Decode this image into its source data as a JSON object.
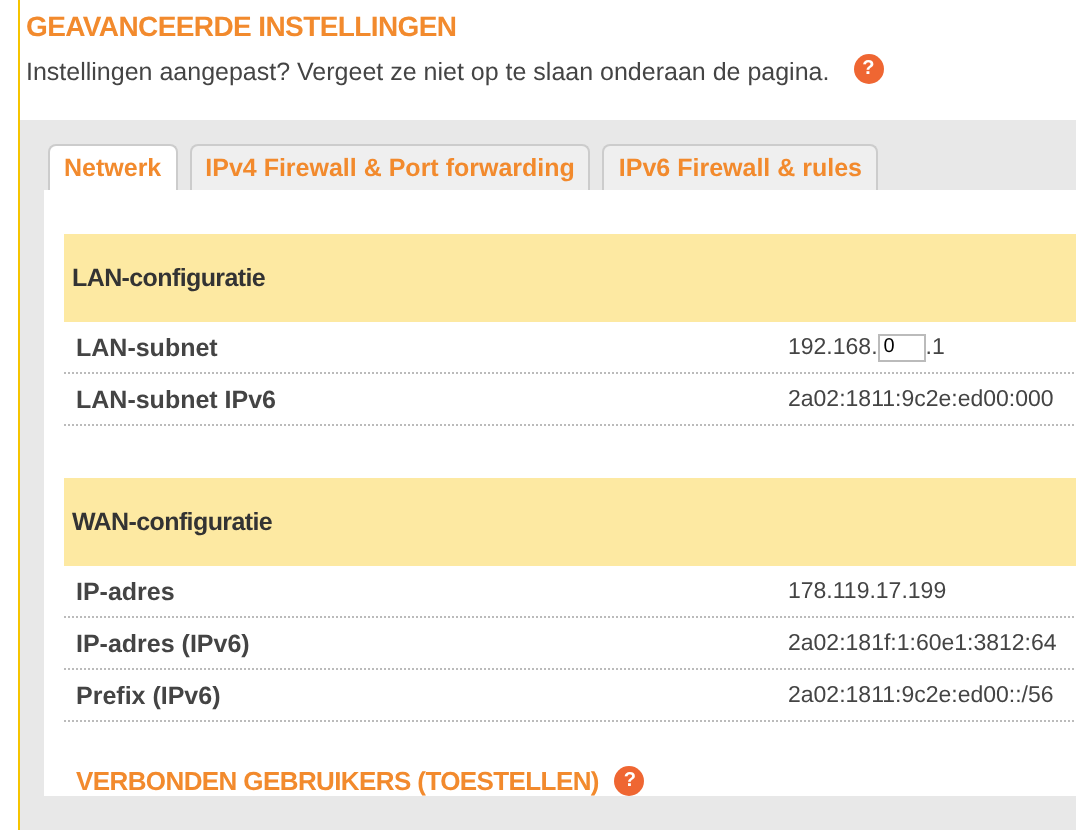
{
  "header": {
    "title": "GEAVANCEERDE INSTELLINGEN",
    "subtitle": "Instellingen aangepast? Vergeet ze niet op te slaan onderaan de pagina.",
    "help": "?"
  },
  "tabs": [
    {
      "label": "Netwerk",
      "selected": true
    },
    {
      "label": "IPv4 Firewall & Port forwarding",
      "selected": false
    },
    {
      "label": "IPv6 Firewall & rules",
      "selected": false
    }
  ],
  "sections": [
    {
      "title": "LAN-configuratie",
      "rows": [
        {
          "kind": "input",
          "label": "LAN-subnet",
          "prefix": "192.168.",
          "value": "0",
          "suffix": ".1"
        },
        {
          "kind": "text",
          "label": "LAN-subnet IPv6",
          "value": "2a02:1811:9c2e:ed00:000"
        }
      ]
    },
    {
      "title": "WAN-configuratie",
      "rows": [
        {
          "kind": "text",
          "label": "IP-adres",
          "value": "178.119.17.199"
        },
        {
          "kind": "text",
          "label": "IP-adres (IPv6)",
          "value": "2a02:181f:1:60e1:3812:64"
        },
        {
          "kind": "text",
          "label": "Prefix (IPv6)",
          "value": "2a02:1811:9c2e:ed00::/56"
        }
      ]
    }
  ],
  "footer_heading": {
    "title": "VERBONDEN GEBRUIKERS (TOESTELLEN)",
    "help": "?"
  }
}
